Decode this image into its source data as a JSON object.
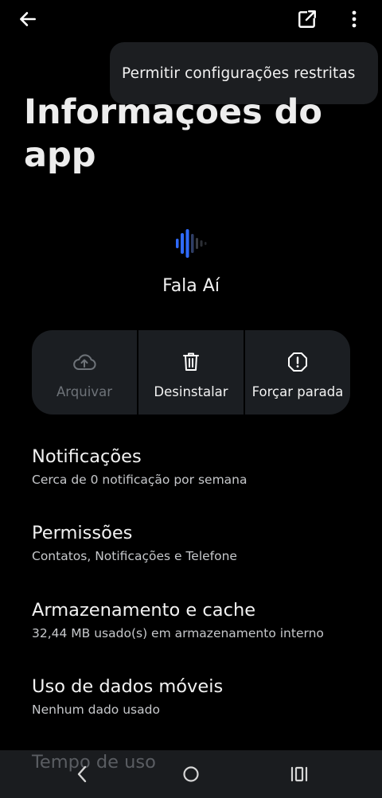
{
  "menu": {
    "items": [
      "Permitir configurações restritas"
    ]
  },
  "page": {
    "title": "Informaçoes do app"
  },
  "app": {
    "name": "Fala Aí"
  },
  "actions": [
    {
      "label": "Arquivar",
      "icon": "cloud-upload-icon",
      "enabled": false
    },
    {
      "label": "Desinstalar",
      "icon": "trash-icon",
      "enabled": true
    },
    {
      "label": "Forçar parada",
      "icon": "alert-octagon-icon",
      "enabled": true
    }
  ],
  "settings": [
    {
      "title": "Notificações",
      "subtitle": "Cerca de 0 notificação por semana"
    },
    {
      "title": "Permissões",
      "subtitle": "Contatos, Notificações e Telefone"
    },
    {
      "title": "Armazenamento e cache",
      "subtitle": "32,44 MB usado(s) em armazenamento interno"
    },
    {
      "title": "Uso de dados móveis",
      "subtitle": "Nenhum dado usado"
    },
    {
      "title": "Tempo de uso",
      "subtitle": ""
    }
  ],
  "colors": {
    "background": "#000000",
    "surface": "#1b1e22",
    "text": "#f2f2f2",
    "subtext": "#c6c8cb",
    "disabled": "#6e7379",
    "accent_blue": "#2f6bff"
  }
}
